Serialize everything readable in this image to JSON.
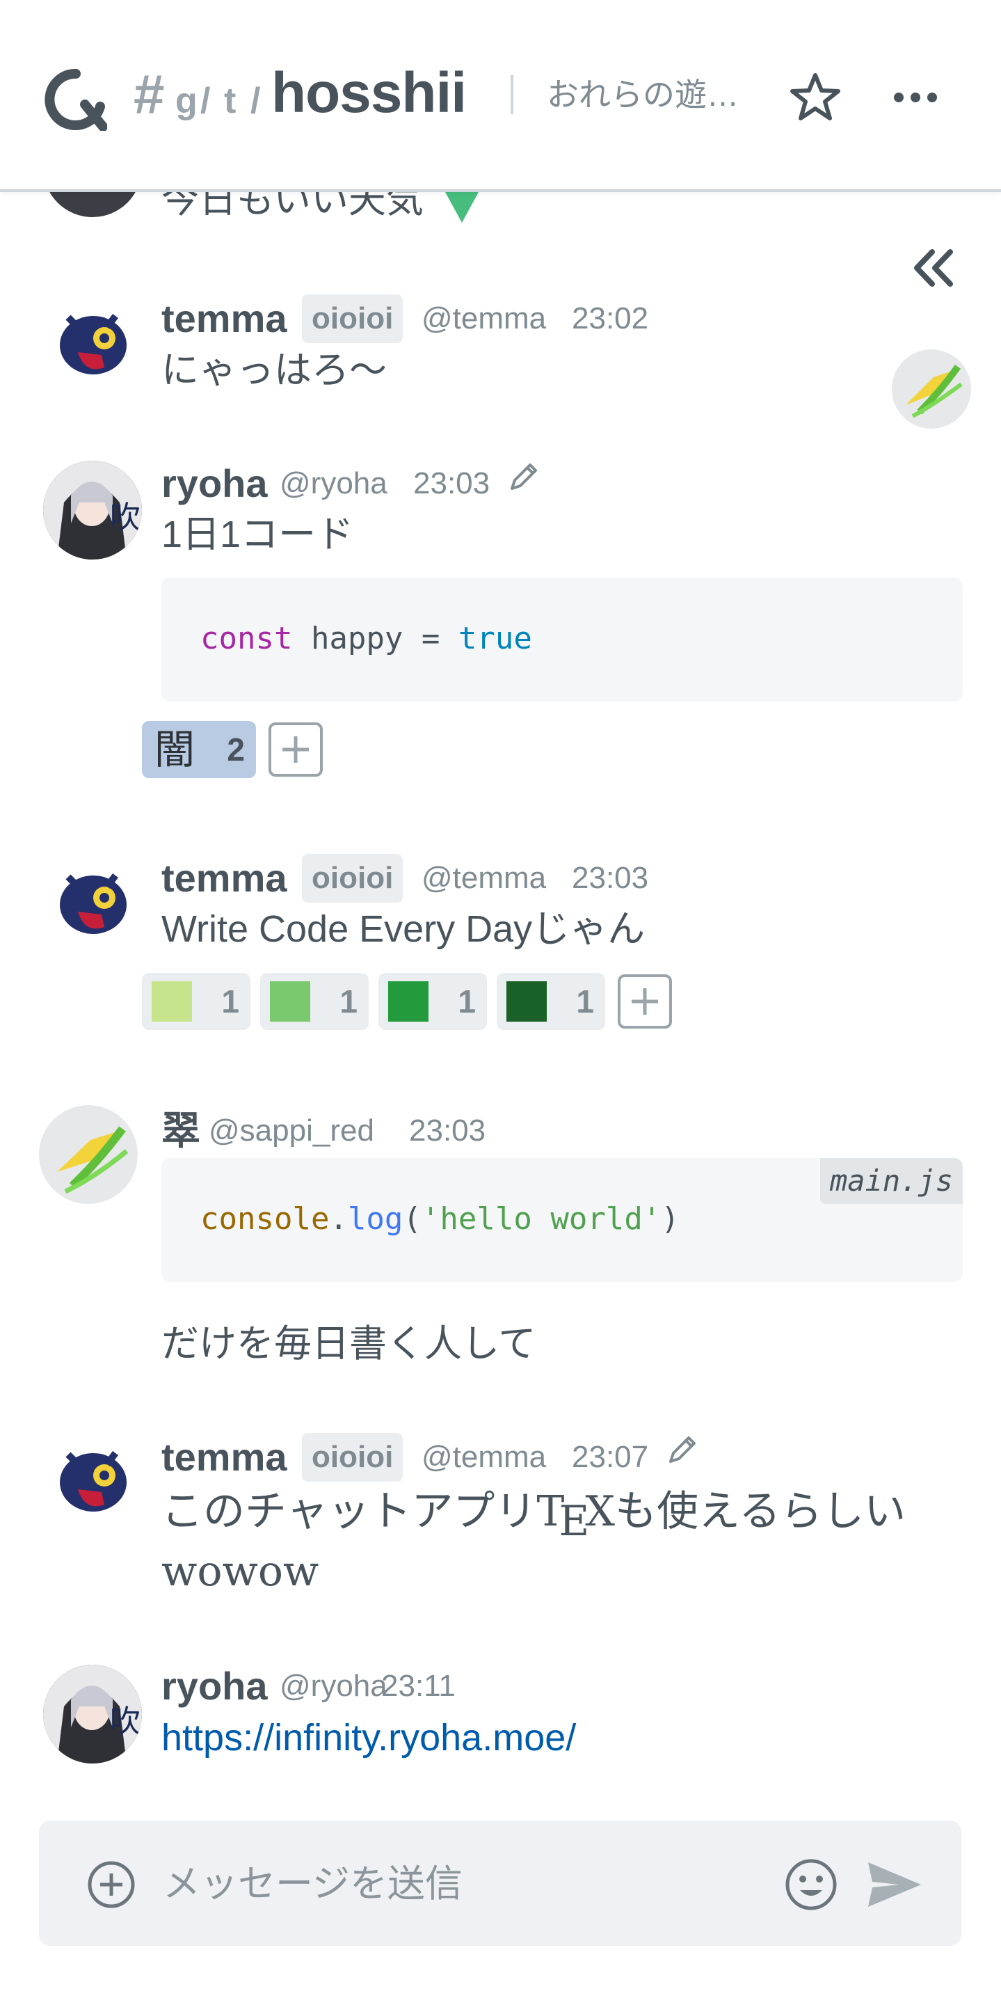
{
  "header": {
    "hash": "#",
    "path_parts": [
      "g",
      "/",
      "t",
      "/"
    ],
    "channel_name": "hosshii",
    "topic": "おれらの遊…"
  },
  "messages": [
    {
      "partial_text": "今日もいい天気"
    },
    {
      "username": "temma",
      "badge": "oioioi",
      "handle": "@temma",
      "time": "23:02",
      "text": "にゃっはろ〜"
    },
    {
      "username": "ryoha",
      "handle": "@ryoha",
      "time": "23:03",
      "text": "1日1コード",
      "code": {
        "keyword": "const",
        "ident": " happy = ",
        "literal": "true"
      },
      "stamps": [
        {
          "glyph": "闇",
          "count": "2"
        }
      ]
    },
    {
      "username": "temma",
      "badge": "oioioi",
      "handle": "@temma",
      "time": "23:03",
      "text": "Write Code Every Dayじゃん",
      "stamps": [
        {
          "color": "#c6e48b",
          "count": "1"
        },
        {
          "color": "#7bc96f",
          "count": "1"
        },
        {
          "color": "#239a3b",
          "count": "1"
        },
        {
          "color": "#196127",
          "count": "1"
        }
      ]
    },
    {
      "username": "翠",
      "handle": "@sappi_red",
      "time": "23:03",
      "code": {
        "filename": "main.js",
        "obj": "console",
        "dot": ".",
        "method": "log",
        "open": "(",
        "str": "'hello world'",
        "close": ")"
      },
      "text": "だけを毎日書く人して"
    },
    {
      "username": "temma",
      "badge": "oioioi",
      "handle": "@temma",
      "time": "23:07",
      "text_pre": "このチャットアプリ",
      "tex_t": "T",
      "tex_e": "E",
      "tex_x": "X",
      "text_post": "も使えるらしい",
      "text2": "wowow"
    },
    {
      "username": "ryoha",
      "handle": "@ryoha",
      "time": "23:11",
      "link": "https://infinity.ryoha.moe/"
    }
  ],
  "composer": {
    "placeholder": "メッセージを送信"
  },
  "icons": {
    "logo": "traq-logo-icon",
    "star": "star-icon",
    "more": "more-icon",
    "collapse": "chevrons-left-icon",
    "edit": "pencil-icon",
    "add": "plus-circle-icon",
    "emoji": "emoji-icon",
    "send": "send-icon"
  },
  "colors": {
    "accent": "#005bac",
    "text": "#49535b",
    "muted": "#7f8a91",
    "stamp_active": "#b9cbe3"
  }
}
